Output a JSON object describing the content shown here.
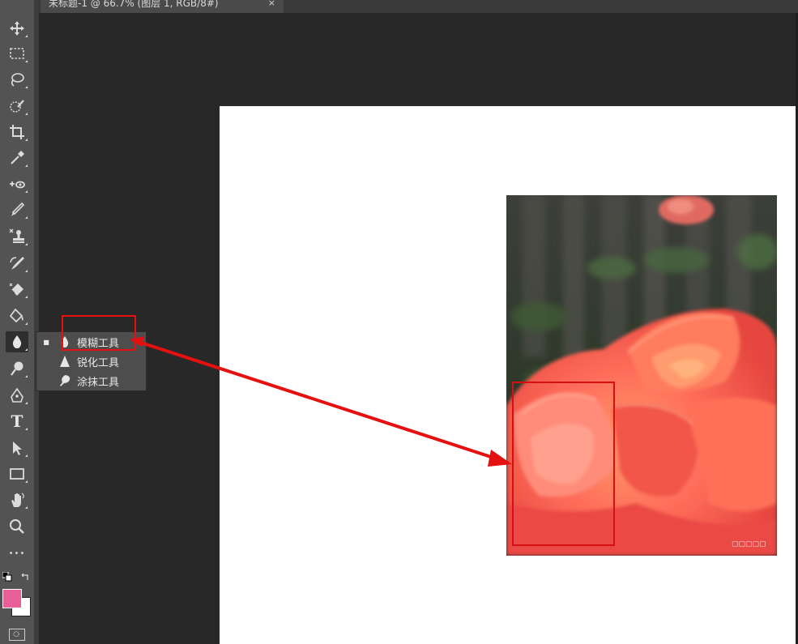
{
  "document": {
    "tab_title": "未标题-1 @ 66.7% (图层 1, RGB/8#)",
    "close_label": "×"
  },
  "toolbar": {
    "tools": [
      {
        "name": "move-tool",
        "icon": "move-icon"
      },
      {
        "name": "marquee-tool",
        "icon": "marquee-icon"
      },
      {
        "name": "lasso-tool",
        "icon": "lasso-icon"
      },
      {
        "name": "quick-select-tool",
        "icon": "quick-select-icon"
      },
      {
        "name": "crop-tool",
        "icon": "crop-icon"
      },
      {
        "name": "eyedropper-tool",
        "icon": "eyedropper-icon"
      },
      {
        "name": "healing-tool",
        "icon": "healing-icon"
      },
      {
        "name": "brush-tool",
        "icon": "brush-icon"
      },
      {
        "name": "clone-stamp-tool",
        "icon": "stamp-icon"
      },
      {
        "name": "history-brush-tool",
        "icon": "history-brush-icon"
      },
      {
        "name": "eraser-tool",
        "icon": "eraser-icon"
      },
      {
        "name": "paint-bucket-tool",
        "icon": "paint-bucket-icon"
      },
      {
        "name": "blur-tool",
        "icon": "drop-icon"
      },
      {
        "name": "dodge-tool",
        "icon": "dodge-icon"
      },
      {
        "name": "pen-tool",
        "icon": "pen-icon"
      },
      {
        "name": "type-tool",
        "icon": "type-icon",
        "glyph": "T"
      },
      {
        "name": "path-select-tool",
        "icon": "arrow-cursor-icon"
      },
      {
        "name": "rectangle-tool",
        "icon": "rectangle-icon"
      },
      {
        "name": "hand-tool",
        "icon": "hand-icon"
      },
      {
        "name": "zoom-tool",
        "icon": "zoom-icon"
      },
      {
        "name": "more-tools",
        "icon": "ellipsis-icon",
        "glyph": "•••"
      }
    ],
    "foreground_color": "#e85e97",
    "background_color": "#ffffff"
  },
  "flyout": {
    "items": [
      {
        "label": "模糊工具",
        "icon": "blur-drop-icon",
        "selected": true
      },
      {
        "label": "锐化工具",
        "icon": "sharpen-triangle-icon",
        "selected": false
      },
      {
        "label": "涂抹工具",
        "icon": "smudge-finger-icon",
        "selected": false
      }
    ],
    "bullet": "■"
  },
  "colors": {
    "annotation_red": "#e51010",
    "canvas": "#ffffff",
    "workspace": "#282828",
    "toolbar": "#535353"
  }
}
